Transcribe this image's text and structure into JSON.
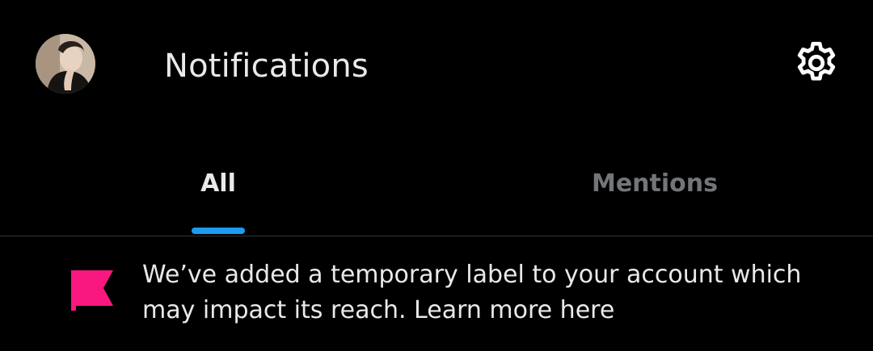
{
  "header": {
    "title": "Notifications",
    "avatar_icon": "profile-photo",
    "settings_icon": "gear-icon"
  },
  "tabs": [
    {
      "label": "All",
      "selected": true
    },
    {
      "label": "Mentions",
      "selected": false
    }
  ],
  "notice": {
    "icon": "flag-icon",
    "text": "We’ve added a temporary label to your account which may impact its reach.",
    "link_text": "Learn more here"
  },
  "colors": {
    "background": "#000000",
    "primary_text": "#e7e9ea",
    "secondary_text": "#71767b",
    "accent": "#1d9bf0",
    "flag": "#f91880",
    "divider": "#2f3336"
  }
}
